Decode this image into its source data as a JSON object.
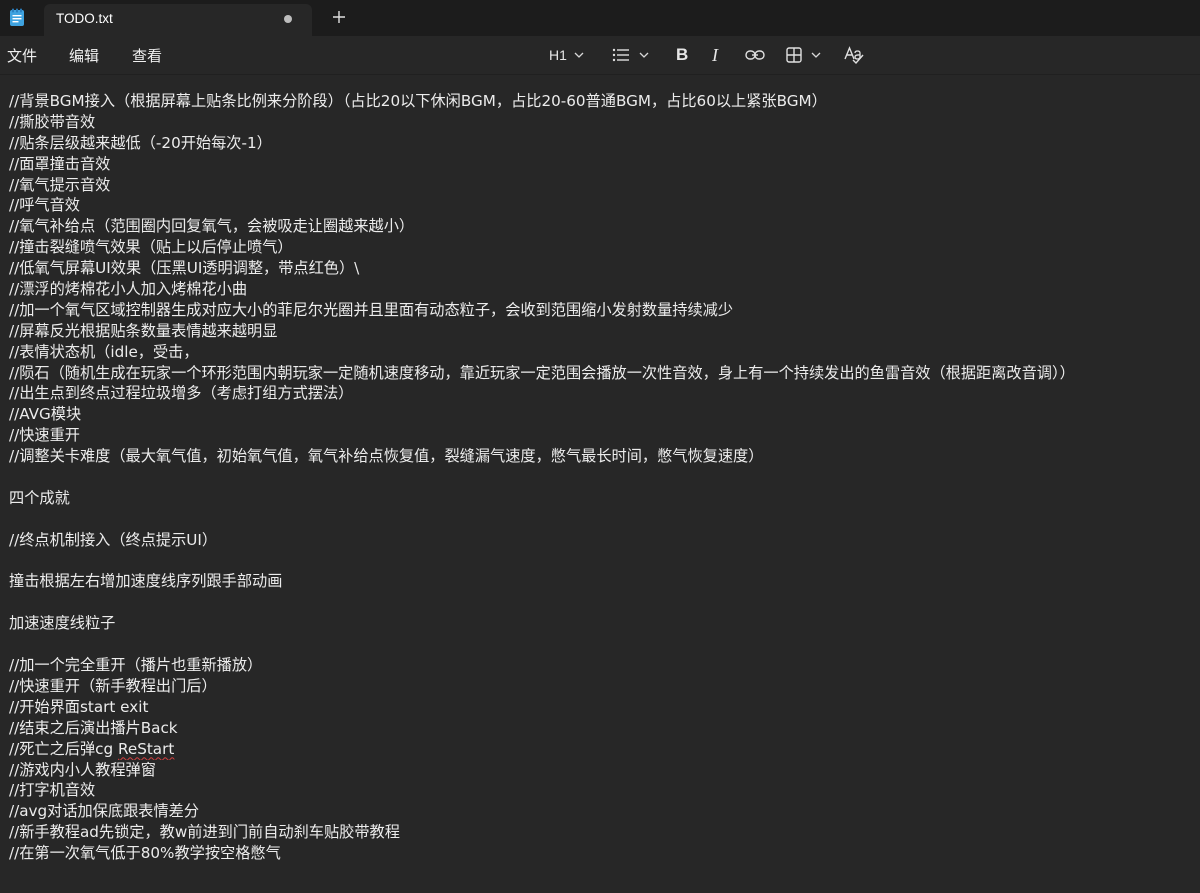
{
  "tab": {
    "title": "TODO.txt",
    "app_icon": "notepad-icon",
    "unsaved_indicator": "dot-icon",
    "new_tab_icon": "plus-icon"
  },
  "menu": {
    "file": "文件",
    "edit": "编辑",
    "view": "查看"
  },
  "toolbar": {
    "heading_label": "H1",
    "icons": [
      "chevron-down-icon",
      "list-icon",
      "bold-icon",
      "italic-icon",
      "link-icon",
      "table-icon",
      "spellcheck-icon"
    ]
  },
  "colors": {
    "titlebar": "#1c1c1c",
    "editor_bg": "#272727",
    "text": "#ececec",
    "spellcheck_underline": "#d04040"
  },
  "document": {
    "lines": [
      "//背景BGM接入（根据屏幕上贴条比例来分阶段）（占比20以下休闲BGM，占比20-60普通BGM，占比60以上紧张BGM）",
      "//撕胶带音效",
      "//贴条层级越来越低（-20开始每次-1）",
      "//面罩撞击音效",
      "//氧气提示音效",
      "//呼气音效",
      "//氧气补给点（范围圈内回复氧气，会被吸走让圈越来越小）",
      "//撞击裂缝喷气效果（贴上以后停止喷气）",
      "//低氧气屏幕UI效果（压黑UI透明调整，带点红色）\\",
      "//漂浮的烤棉花小人加入烤棉花小曲",
      "//加一个氧气区域控制器生成对应大小的菲尼尔光圈并且里面有动态粒子，会收到范围缩小发射数量持续减少",
      "//屏幕反光根据贴条数量表情越来越明显",
      "//表情状态机（idle，受击，",
      "//陨石（随机生成在玩家一个环形范围内朝玩家一定随机速度移动，靠近玩家一定范围会播放一次性音效，身上有一个持续发出的鱼雷音效（根据距离改音调））",
      "//出生点到终点过程垃圾增多（考虑打组方式摆法）",
      "//AVG模块",
      "//快速重开",
      "//调整关卡难度（最大氧气值，初始氧气值，氧气补给点恢复值，裂缝漏气速度，憋气最长时间，憋气恢复速度）",
      "",
      "四个成就",
      "",
      "//终点机制接入（终点提示UI）",
      "",
      "撞击根据左右增加速度线序列跟手部动画",
      "",
      "加速速度线粒子",
      "",
      "//加一个完全重开（播片也重新播放）",
      "//快速重开（新手教程出门后）",
      "//开始界面start exit",
      "//结束之后演出播片Back",
      "//死亡之后弹cg ",
      "//游戏内小人教程弹窗",
      "//打字机音效",
      "//avg对话加保底跟表情差分",
      "//新手教程ad先锁定，教w前进到门前自动刹车贴胶带教程",
      "//在第一次氧气低于80%教学按空格憋气"
    ],
    "spellcheck_word": "ReStart"
  }
}
